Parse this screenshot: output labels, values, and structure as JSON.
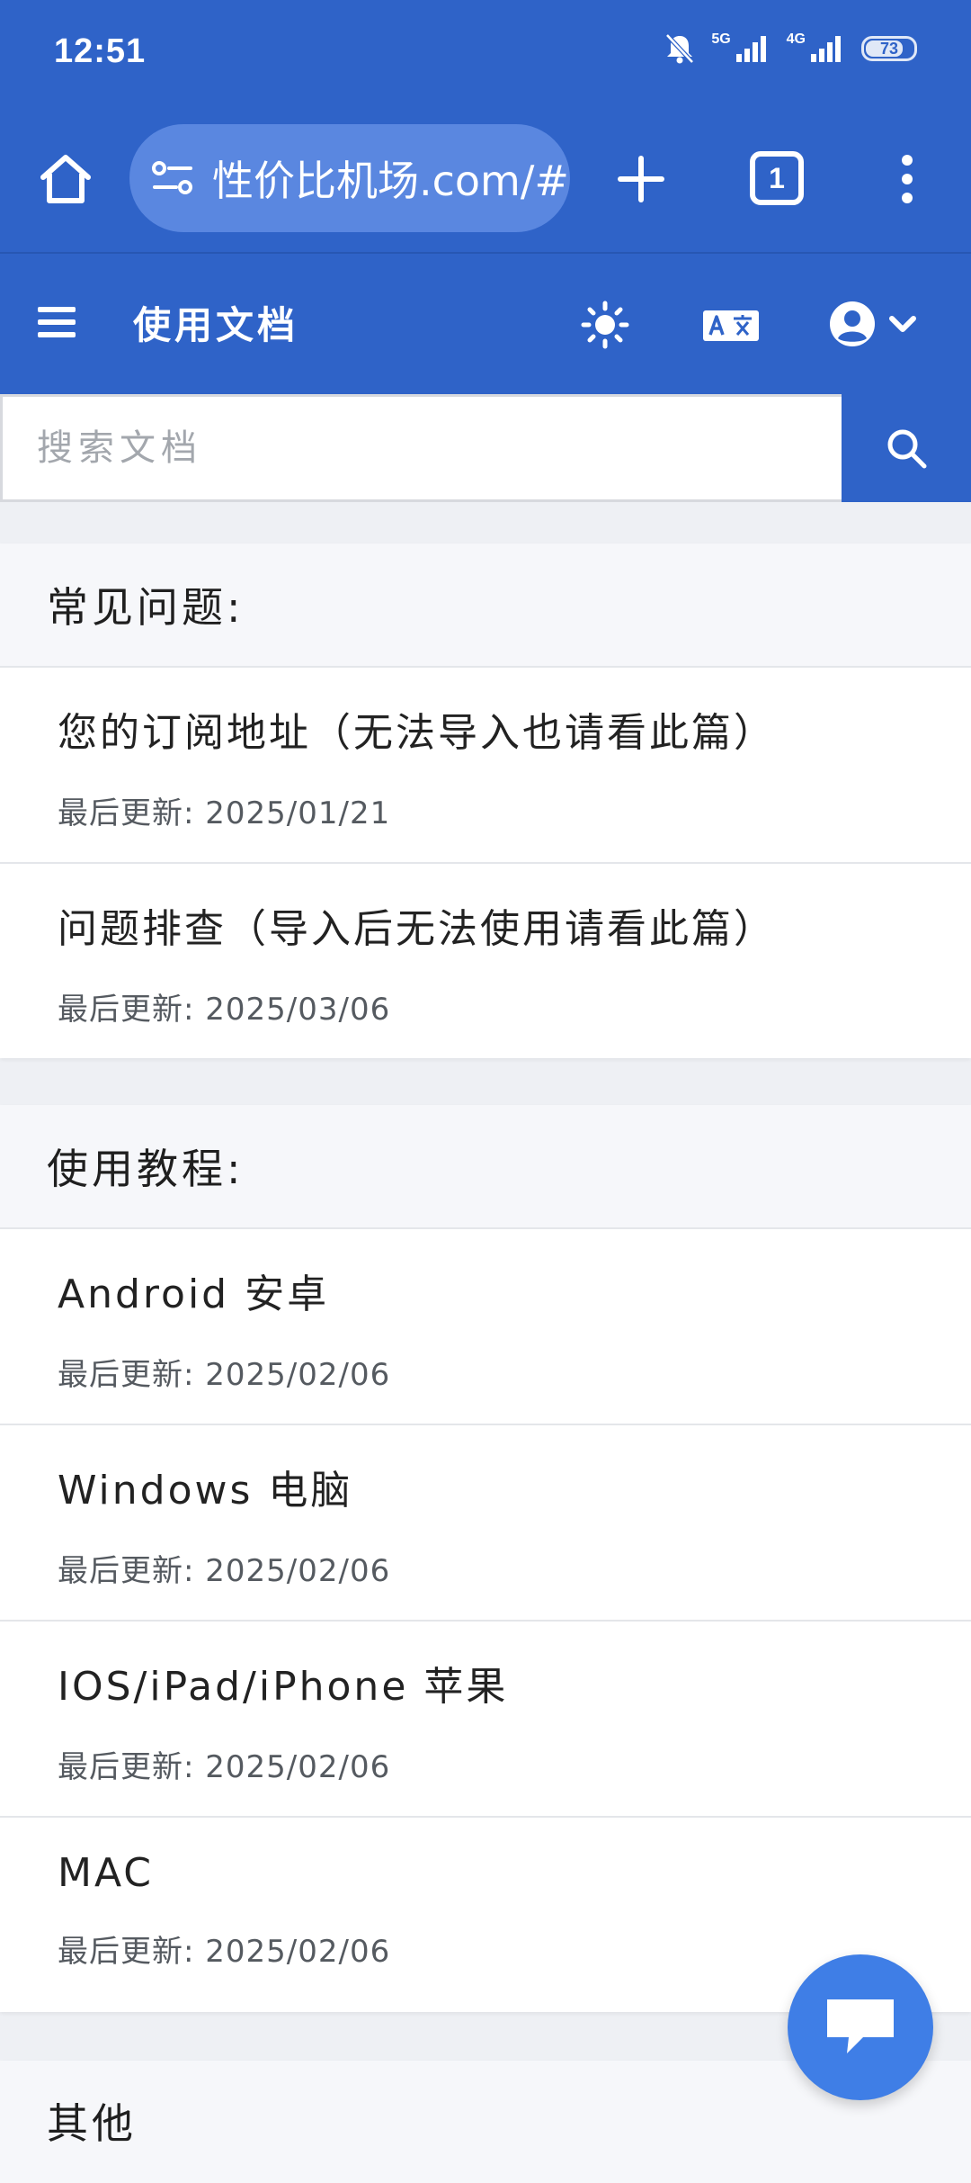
{
  "status_bar": {
    "time": "12:51",
    "network_1": "5G",
    "network_2": "4G",
    "battery": "73",
    "battery_level": 0.73
  },
  "browser": {
    "url": "性价比机场.com/#",
    "tab_count": "1",
    "icons": [
      "home-icon",
      "site-info-icon",
      "add-tab-icon",
      "tab-switcher-icon",
      "more-vertical-icon"
    ]
  },
  "header": {
    "title": "使用文档",
    "icons": [
      "hamburger-menu-icon",
      "sun-theme-icon",
      "translate-icon",
      "user-account-icon",
      "chevron-down-icon"
    ]
  },
  "search": {
    "placeholder": "搜索文档"
  },
  "sections": [
    {
      "title": "常见问题:",
      "items": [
        {
          "title": "您的订阅地址（无法导入也请看此篇）",
          "updated": "最后更新: 2025/01/21"
        },
        {
          "title": "问题排查（导入后无法使用请看此篇）",
          "updated": "最后更新: 2025/03/06"
        }
      ]
    },
    {
      "title": "使用教程:",
      "items": [
        {
          "title": "Android 安卓",
          "updated": "最后更新: 2025/02/06"
        },
        {
          "title": "Windows 电脑",
          "updated": "最后更新: 2025/02/06"
        },
        {
          "title": "IOS/iPad/iPhone 苹果",
          "updated": "最后更新: 2025/02/06"
        },
        {
          "title": "MAC",
          "updated": "最后更新: 2025/02/06"
        }
      ]
    },
    {
      "title": "其他",
      "items": []
    }
  ],
  "colors": {
    "primary": "#2f63c8",
    "fab": "#3f7ee6",
    "background": "#eef0f4"
  }
}
